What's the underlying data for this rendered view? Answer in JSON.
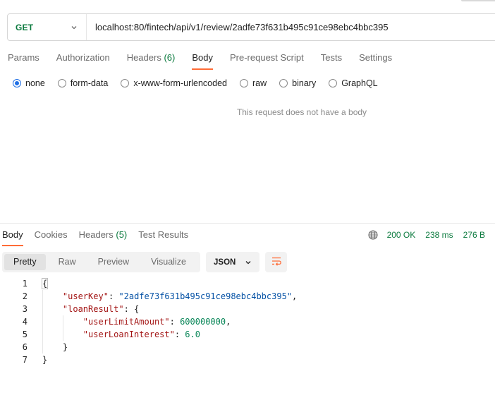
{
  "request": {
    "method": "GET",
    "url": "localhost:80/fintech/api/v1/review/2adfe73f631b495c91ce98ebc4bbc395",
    "tabs": [
      {
        "label": "Params"
      },
      {
        "label": "Authorization"
      },
      {
        "label": "Headers",
        "count": "(6)"
      },
      {
        "label": "Body"
      },
      {
        "label": "Pre-request Script"
      },
      {
        "label": "Tests"
      },
      {
        "label": "Settings"
      }
    ],
    "active_tab": "Body",
    "body_options": [
      "none",
      "form-data",
      "x-www-form-urlencoded",
      "raw",
      "binary",
      "GraphQL"
    ],
    "selected_body_option": "none",
    "empty_body_message": "This request does not have a body"
  },
  "response": {
    "tabs": [
      {
        "label": "Body"
      },
      {
        "label": "Cookies"
      },
      {
        "label": "Headers",
        "count": "(5)"
      },
      {
        "label": "Test Results"
      }
    ],
    "active_tab": "Body",
    "status": "200 OK",
    "time": "238 ms",
    "size": "276 B",
    "view_modes": [
      "Pretty",
      "Raw",
      "Preview",
      "Visualize"
    ],
    "active_view": "Pretty",
    "format": "JSON",
    "code_lines": [
      {
        "num": "1"
      },
      {
        "num": "2",
        "key": "\"userKey\"",
        "value": "\"2adfe73f631b495c91ce98ebc4bbc395\"",
        "value_type": "str",
        "trail": ","
      },
      {
        "num": "3",
        "key": "\"loanResult\"",
        "open": "{"
      },
      {
        "num": "4",
        "key": "\"userLimitAmount\"",
        "value": "600000000",
        "value_type": "num",
        "trail": ","
      },
      {
        "num": "5",
        "key": "\"userLoanInterest\"",
        "value": "6.0",
        "value_type": "num",
        "trail": ""
      },
      {
        "num": "6",
        "close": "}"
      },
      {
        "num": "7",
        "close": "}"
      }
    ],
    "open_brace": "{"
  },
  "colors": {
    "accent": "#ff6c37",
    "method_get": "#0b7a3e",
    "radio_selected": "#1f6fe5",
    "status_ok": "#0b7a3e"
  },
  "icons": {
    "method_dropdown": "chevron-down-icon",
    "response_globe": "globe-icon",
    "format_dropdown": "chevron-down-icon",
    "wrap_lines": "wrap-lines-icon"
  }
}
